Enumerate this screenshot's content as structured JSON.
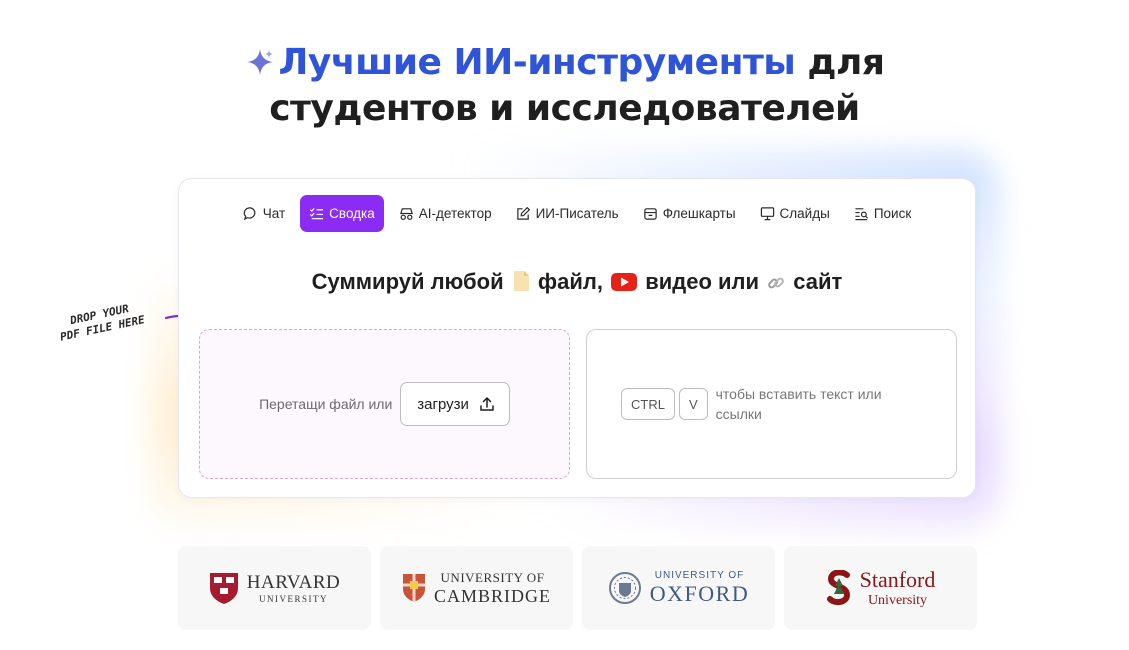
{
  "hero": {
    "title_accent": "Лучшие ИИ-инструменты",
    "title_rest": "для",
    "title_line2": "студентов и исследователей"
  },
  "tabs": [
    {
      "label": "Чат",
      "icon": "chat-bubble-icon",
      "active": false
    },
    {
      "label": "Сводка",
      "icon": "checklist-icon",
      "active": true
    },
    {
      "label": "AI-детектор",
      "icon": "detector-icon",
      "active": false
    },
    {
      "label": "ИИ-Писатель",
      "icon": "pencil-square-icon",
      "active": false
    },
    {
      "label": "Флешкарты",
      "icon": "flashcards-icon",
      "active": false
    },
    {
      "label": "Слайды",
      "icon": "presentation-icon",
      "active": false
    },
    {
      "label": "Поиск",
      "icon": "search-list-icon",
      "active": false
    }
  ],
  "headline": {
    "part1": "Суммируй любой",
    "part2": "файл,",
    "part3": "видео или",
    "part4": "сайт"
  },
  "drop": {
    "text": "Перетащи файл или",
    "button": "загрузи",
    "note_line1": "DROP YOUR",
    "note_line2": "PDF FILE HERE"
  },
  "paste": {
    "key1": "CTRL",
    "key2": "V",
    "text": "чтобы вставить текст или ссылки"
  },
  "logos": {
    "harvard": {
      "line1": "HARVARD",
      "line2": "UNIVERSITY"
    },
    "cambridge": {
      "line1": "UNIVERSITY OF",
      "line2": "CAMBRIDGE"
    },
    "oxford": {
      "line1": "UNIVERSITY OF",
      "line2": "OXFORD"
    },
    "stanford": {
      "line1": "Stanford",
      "line2": "University"
    }
  },
  "colors": {
    "accent": "#2f54d8",
    "active_tab": "#8b2cf5"
  }
}
